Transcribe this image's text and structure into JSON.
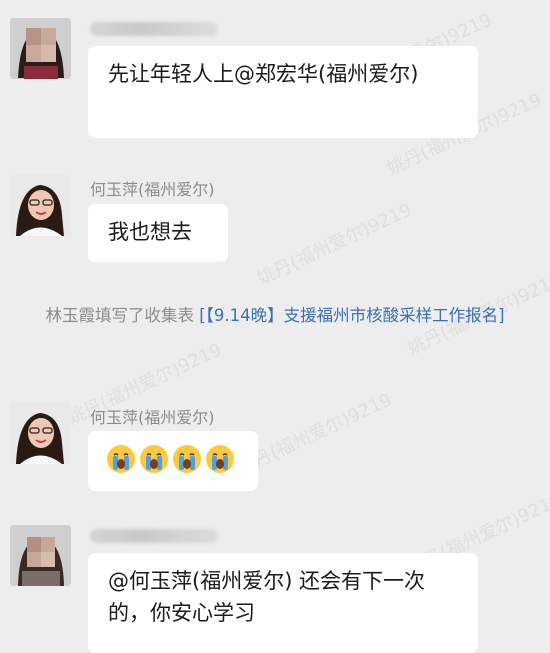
{
  "messages": [
    {
      "sender": "",
      "text": "先让年轻人上@郑宏华(福州爱尔)"
    },
    {
      "sender": "何玉萍(福州爱尔)",
      "text": "我也想去"
    },
    {
      "sender": "何玉萍(福州爱尔)",
      "emoji": [
        "loudly-crying-face",
        "loudly-crying-face",
        "loudly-crying-face",
        "loudly-crying-face"
      ]
    },
    {
      "sender": "",
      "text": "@何玉萍(福州爱尔)  还会有下一次的，你安心学习"
    }
  ],
  "system_notice": {
    "prefix": "林玉霞填写了收集表 ",
    "link": "[【9.14晚】支援福州市核酸采样工作报名]"
  },
  "watermark": "姚丹(福州爱尔)9219",
  "colors": {
    "background": "#ededed",
    "bubble": "#ffffff",
    "link": "#3b6fb6",
    "muted_text": "#8c8c8c"
  }
}
